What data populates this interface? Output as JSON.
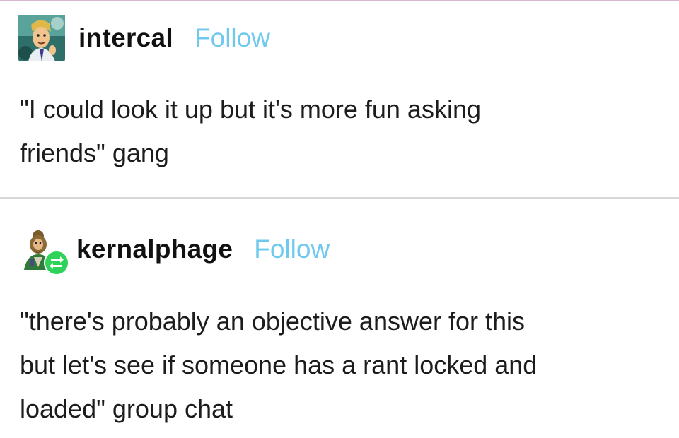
{
  "posts": [
    {
      "username": "intercal",
      "follow_label": "Follow",
      "avatar_icon": "cartoon-character-avatar-icon",
      "text": "\"I could look it up but it's more fun asking\nfriends\" gang"
    },
    {
      "username": "kernalphage",
      "follow_label": "Follow",
      "avatar_icon": "bearded-character-avatar-icon",
      "reblog_icon": "reblog-icon",
      "text": "\"there's probably an objective answer for this\nbut let's see if someone has a rant locked and\nloaded\" group chat"
    }
  ],
  "colors": {
    "follow": "#6fc9ef",
    "reblog_badge": "#2fd35a",
    "divider": "#d8d8d8",
    "top_border": "#d9b7d4"
  }
}
